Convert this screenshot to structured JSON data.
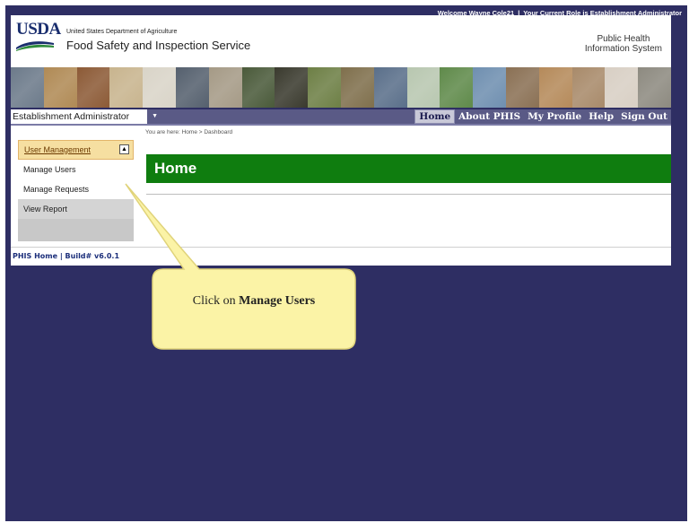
{
  "topbar": {
    "welcome": "Welcome Wayne Cole21",
    "separator": "|",
    "role_text": "Your Current Role is Establishment Administrator"
  },
  "header": {
    "logo_text": "USDA",
    "department": "United States Department of Agriculture",
    "agency": "Food Safety and Inspection Service",
    "system_line1": "Public Health",
    "system_line2": "Information System"
  },
  "photostrip": {
    "colors": [
      "#6c7a8a",
      "#b08a55",
      "#8c5a36",
      "#c8b48e",
      "#d9d4c8",
      "#55606e",
      "#a59a86",
      "#4a5a3a",
      "#3a3a2e",
      "#6d7f45",
      "#7f6f4c",
      "#5a6f8a",
      "#b8c7b0",
      "#5f8a4a",
      "#6f8fb0",
      "#8a7054",
      "#b58a5a",
      "#a88a6a",
      "#d8cfc4",
      "#8d8a80"
    ]
  },
  "nav": {
    "role_select": "Establishment Administrator",
    "links": {
      "home": "Home",
      "about": "About PHIS",
      "profile": "My Profile",
      "help": "Help",
      "signout": "Sign Out"
    }
  },
  "sidebar": {
    "section_label": "User Management",
    "toggle_glyph": "▲",
    "items": [
      "Manage Users",
      "Manage Requests",
      "View Report"
    ]
  },
  "main": {
    "breadcrumb": "You are here: Home > Dashboard",
    "title": "Home"
  },
  "footer": {
    "text": "PHIS Home | Build# v6.0.1"
  },
  "callout": {
    "prefix": "Click on",
    "target": "Manage Users"
  },
  "colors": {
    "background": "#2e2e63",
    "banner": "#0f7d0f",
    "callout_fill": "#fbf3a6",
    "sidebar_header": "#f6dfa1",
    "nav": "#5a5a86"
  }
}
